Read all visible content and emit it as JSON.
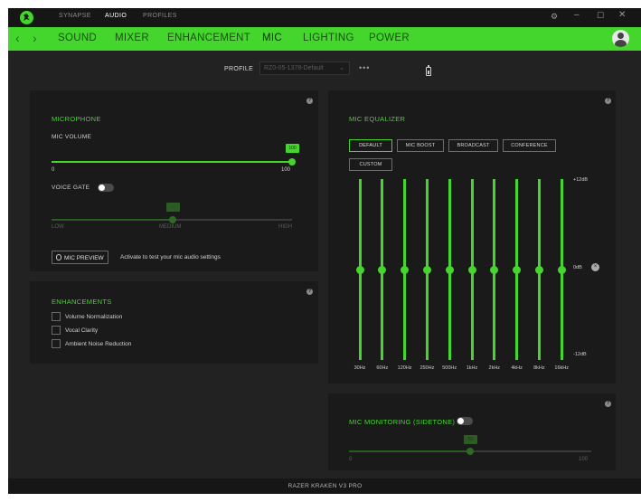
{
  "titlebar": {
    "tabs": [
      "SYNAPSE",
      "AUDIO",
      "PROFILES"
    ],
    "active_tab": "AUDIO",
    "icons": [
      "razer-logo-icon",
      "gear-icon",
      "minimize-icon",
      "maximize-icon",
      "close-icon"
    ]
  },
  "nav": {
    "back": "‹",
    "forward": "›",
    "tabs": [
      "SOUND",
      "MIXER",
      "ENHANCEMENT",
      "MIC",
      "LIGHTING",
      "POWER"
    ],
    "active_tab": "MIC"
  },
  "profile": {
    "label": "PROFILE",
    "value": "RZ0-05-1378-Default",
    "chevron": "⌄",
    "more": "•••"
  },
  "microphone": {
    "title": "MICROPHONE",
    "volume_label": "MIC VOLUME",
    "volume_value": 100,
    "volume_value_text": "100",
    "min": "0",
    "max": "100",
    "voice_gate_label": "VOICE GATE",
    "voice_gate_on": false,
    "gate_levels": [
      "LOW",
      "MEDIUM",
      "HIGH"
    ],
    "gate_value": 0.5,
    "gate_value_text": "--",
    "mic_preview_label": "MIC PREVIEW",
    "mic_preview_hint": "Activate to test your mic audio settings"
  },
  "enhancements": {
    "title": "ENHANCEMENTS",
    "items": [
      {
        "label": "Volume Normalization",
        "checked": false
      },
      {
        "label": "Vocal Clarity",
        "checked": false
      },
      {
        "label": "Ambient Noise Reduction",
        "checked": false
      }
    ]
  },
  "equalizer": {
    "title": "MIC EQUALIZER",
    "presets": [
      "DEFAULT",
      "MIC BOOST",
      "BROADCAST",
      "CONFERENCE",
      "CUSTOM"
    ],
    "active_preset": "DEFAULT",
    "db_top": "+12dB",
    "db_mid": "0dB",
    "db_bottom": "-12dB",
    "bands": [
      "30Hz",
      "60Hz",
      "120Hz",
      "250Hz",
      "500Hz",
      "1kHz",
      "2kHz",
      "4kHz",
      "8kHz",
      "16kHz"
    ],
    "gains_db": [
      0,
      0,
      0,
      0,
      0,
      0,
      0,
      0,
      0,
      0
    ]
  },
  "monitoring": {
    "title": "MIC MONITORING (SIDETONE)",
    "enabled": false,
    "min": "0",
    "max": "100",
    "value": 50,
    "value_text": "50"
  },
  "footer": {
    "device_name": "RAZER KRAKEN V3 PRO"
  },
  "help_icon": "?",
  "reset_icon": "×",
  "colors": {
    "accent": "#44d62c",
    "background": "#222222",
    "panel": "#1a1a1a"
  }
}
